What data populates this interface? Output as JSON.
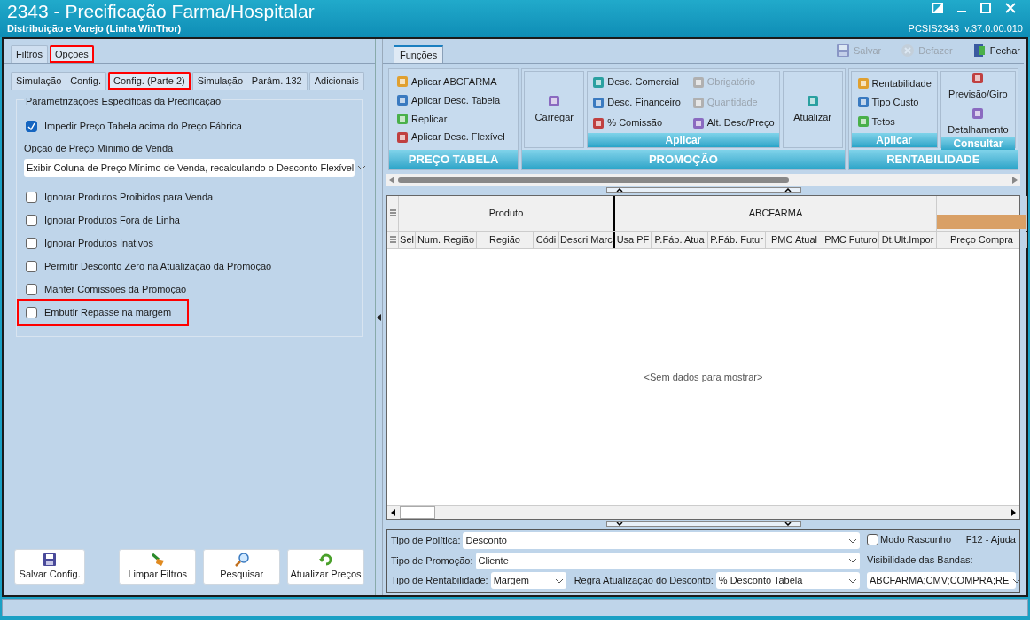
{
  "window": {
    "title": "2343 - Precificação Farma/Hospitalar",
    "subtitle": "Distribuição e Varejo (Linha WinThor)",
    "version": "PCSIS2343  v.37.0.00.010"
  },
  "left_tabs": [
    {
      "label": "Filtros",
      "selected": false,
      "highlighted": false
    },
    {
      "label": "Opções",
      "selected": true,
      "highlighted": true
    }
  ],
  "sub_tabs": [
    {
      "label": "Simulação - Config.",
      "selected": false,
      "highlighted": false
    },
    {
      "label": "Config. (Parte 2)",
      "selected": true,
      "highlighted": true
    },
    {
      "label": "Simulação - Parâm. 132",
      "selected": false,
      "highlighted": false
    },
    {
      "label": "Adicionais",
      "selected": false,
      "highlighted": false
    }
  ],
  "group_title": "Parametrizações Específicas da Precificação",
  "options": [
    {
      "kind": "checkbox",
      "label": "Impedir Preço Tabela acima do Preço Fábrica",
      "checked": true,
      "highlighted": false
    },
    {
      "kind": "label",
      "label": "Opção de Preço Mínimo de Venda"
    },
    {
      "kind": "select",
      "value": "Exibir Coluna de Preço Mínimo de Venda, recalculando o Desconto Flexível"
    },
    {
      "kind": "checkbox",
      "label": "Ignorar Produtos Proibidos para Venda",
      "checked": false,
      "highlighted": false
    },
    {
      "kind": "checkbox",
      "label": "Ignorar Produtos Fora de Linha",
      "checked": false,
      "highlighted": false
    },
    {
      "kind": "checkbox",
      "label": "Ignorar Produtos Inativos",
      "checked": false,
      "highlighted": false
    },
    {
      "kind": "checkbox",
      "label": "Permitir Desconto Zero na Atualização da Promoção",
      "checked": false,
      "highlighted": false
    },
    {
      "kind": "checkbox",
      "label": "Manter Comissões da Promoção",
      "checked": false,
      "highlighted": false
    },
    {
      "kind": "checkbox",
      "label": "Embutir Repasse na margem",
      "checked": false,
      "highlighted": true
    }
  ],
  "buttons": [
    {
      "label": "Salvar Config."
    },
    {
      "label": "Limpar Filtros"
    },
    {
      "label": "Pesquisar"
    },
    {
      "label": "Atualizar Preços"
    }
  ],
  "ribbon": {
    "tab": "Funções",
    "actions": [
      {
        "label": "Salvar",
        "disabled": true
      },
      {
        "label": "Defazer",
        "disabled": true
      },
      {
        "label": "Fechar",
        "disabled": false
      }
    ],
    "groups": [
      {
        "title": "PREÇO TABELA",
        "panels": [
          {
            "kind": "list",
            "items": [
              {
                "label": "Aplicar ABCFARMA",
                "disabled": false
              },
              {
                "label": "Aplicar Desc. Tabela",
                "disabled": false
              },
              {
                "label": "Replicar",
                "disabled": false
              },
              {
                "label": "Aplicar Desc. Flexível",
                "disabled": false
              }
            ]
          }
        ]
      },
      {
        "title": "PROMOÇÃO",
        "panels": [
          {
            "kind": "big",
            "items": [
              {
                "label": "Carregar",
                "disabled": false
              }
            ]
          },
          {
            "kind": "grid",
            "title": "Aplicar",
            "items": [
              {
                "label": "Desc. Comercial",
                "disabled": false
              },
              {
                "label": "Obrigatório",
                "disabled": true
              },
              {
                "label": "Desc. Financeiro",
                "disabled": false
              },
              {
                "label": "Quantidade",
                "disabled": true
              },
              {
                "label": "% Comissão",
                "disabled": false
              },
              {
                "label": "Alt. Desc/Preço",
                "disabled": false
              }
            ]
          },
          {
            "kind": "big",
            "items": [
              {
                "label": "Atualizar",
                "disabled": false
              }
            ]
          }
        ]
      },
      {
        "title": "RENTABILIDADE",
        "panels": [
          {
            "kind": "list",
            "title": "Aplicar",
            "items": [
              {
                "label": "Rentabilidade",
                "disabled": false
              },
              {
                "label": "Tipo Custo",
                "disabled": false
              },
              {
                "label": "Tetos",
                "disabled": false
              }
            ]
          },
          {
            "kind": "stack",
            "title": "Consultar",
            "items": [
              {
                "label": "Previsão/Giro",
                "disabled": false
              },
              {
                "label": "Detalhamento",
                "disabled": false
              }
            ]
          }
        ]
      }
    ]
  },
  "grid": {
    "bands": [
      {
        "label": "Produto",
        "color": "#f0f0f0"
      },
      {
        "label": "ABCFARMA",
        "color": "#f0f0f0"
      },
      {
        "color": "#d9a066"
      }
    ],
    "columns": [
      "Sel",
      "Num. Região",
      "Região",
      "Códi",
      "Descri",
      "Marc",
      "Usa PF",
      "P.Fáb. Atua",
      "P.Fáb. Futur",
      "PMC Atual",
      "PMC Futuro",
      "Dt.Ult.Impor",
      "Preço Compra"
    ],
    "empty_text": "<Sem dados para mostrar>"
  },
  "filters": {
    "politica": {
      "label": "Tipo de Política:",
      "value": "Desconto"
    },
    "promocao": {
      "label": "Tipo de Promoção:",
      "value": "Cliente"
    },
    "rentabilidade": {
      "label": "Tipo de Rentabilidade:",
      "value": "Margem"
    },
    "regra": {
      "label": "Regra Atualização do Desconto:",
      "value": "% Desconto Tabela"
    }
  },
  "modo_rascunho": {
    "label": "Modo Rascunho",
    "checked": false
  },
  "help": "F12 - Ajuda",
  "bands_visibility": {
    "label": "Visibilidade das Bandas:",
    "value": "ABCFARMA;CMV;COMPRA;RE"
  }
}
